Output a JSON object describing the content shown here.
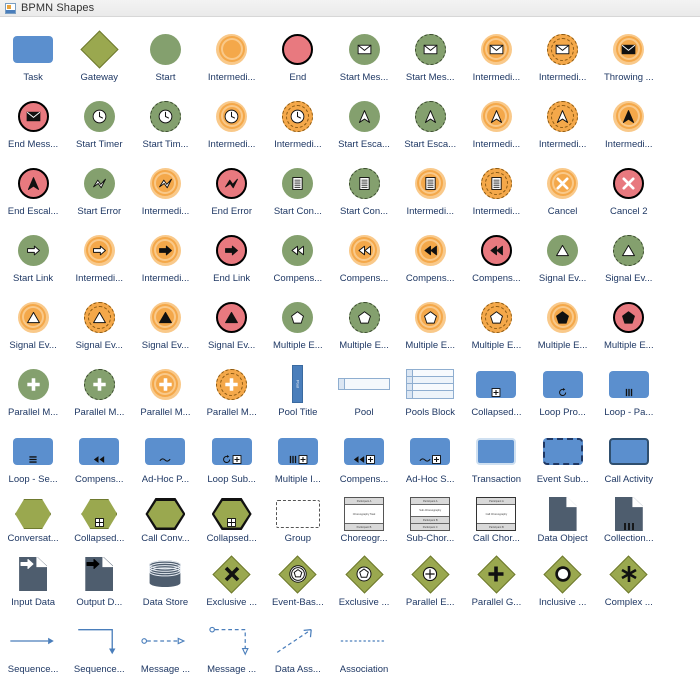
{
  "window": {
    "title": "BPMN Shapes",
    "icon": "bpmn-stencil-icon"
  },
  "theme": {
    "label_color": "#1f3864",
    "green": "#84a06e",
    "orange": "#f5a council",
    "orange_real": "#f3a council",
    "red": "#e8797f",
    "blue_task": "#5b8fce",
    "olive": "#9aa84f",
    "slate": "#4e5d6e",
    "connector_blue": "#4a7ebb"
  },
  "grid": {
    "columns": 10,
    "rows": 8,
    "total_shapes": 80
  },
  "shapes": [
    {
      "label": "Task",
      "kind": "task",
      "variant": "plain"
    },
    {
      "label": "Gateway",
      "kind": "diamond",
      "variant": "plain"
    },
    {
      "label": "Start",
      "kind": "event",
      "variant": "green-solid"
    },
    {
      "label": "Intermedi...",
      "kind": "event",
      "variant": "orange-double"
    },
    {
      "label": "End",
      "kind": "event",
      "variant": "red-thick"
    },
    {
      "label": "Start Mes...",
      "kind": "event",
      "variant": "green-solid",
      "glyph": "envelope-white"
    },
    {
      "label": "Start Mes...",
      "kind": "event",
      "variant": "green-dashed",
      "glyph": "envelope-white"
    },
    {
      "label": "Intermedi...",
      "kind": "event",
      "variant": "orange-double",
      "glyph": "envelope-white"
    },
    {
      "label": "Intermedi...",
      "kind": "event",
      "variant": "orange-dashdbl",
      "glyph": "envelope-white"
    },
    {
      "label": "Throwing ...",
      "kind": "event",
      "variant": "orange-double",
      "glyph": "envelope-black"
    },
    {
      "label": "End Mess...",
      "kind": "event",
      "variant": "red-thick",
      "glyph": "envelope-black"
    },
    {
      "label": "Start Timer",
      "kind": "event",
      "variant": "green-solid",
      "glyph": "clock"
    },
    {
      "label": "Start Tim...",
      "kind": "event",
      "variant": "green-dashed",
      "glyph": "clock"
    },
    {
      "label": "Intermedi...",
      "kind": "event",
      "variant": "orange-double",
      "glyph": "clock"
    },
    {
      "label": "Intermedi...",
      "kind": "event",
      "variant": "orange-dashdbl",
      "glyph": "clock"
    },
    {
      "label": "Start Esca...",
      "kind": "event",
      "variant": "green-solid",
      "glyph": "arrowhead-white"
    },
    {
      "label": "Start Esca...",
      "kind": "event",
      "variant": "green-dashed",
      "glyph": "arrowhead-white"
    },
    {
      "label": "Intermedi...",
      "kind": "event",
      "variant": "orange-double",
      "glyph": "arrowhead-white"
    },
    {
      "label": "Intermedi...",
      "kind": "event",
      "variant": "orange-dashdbl",
      "glyph": "arrowhead-white"
    },
    {
      "label": "Intermedi...",
      "kind": "event",
      "variant": "orange-double",
      "glyph": "arrowhead-black"
    },
    {
      "label": "End Escal...",
      "kind": "event",
      "variant": "red-thick",
      "glyph": "arrowhead-black"
    },
    {
      "label": "Start Error",
      "kind": "event",
      "variant": "green-solid",
      "glyph": "bolt-white"
    },
    {
      "label": "Intermedi...",
      "kind": "event",
      "variant": "orange-double",
      "glyph": "bolt-white"
    },
    {
      "label": "End Error",
      "kind": "event",
      "variant": "red-thick",
      "glyph": "bolt-black"
    },
    {
      "label": "Start Con...",
      "kind": "event",
      "variant": "green-solid",
      "glyph": "page-lines"
    },
    {
      "label": "Start Con...",
      "kind": "event",
      "variant": "green-dashed",
      "glyph": "page-lines"
    },
    {
      "label": "Intermedi...",
      "kind": "event",
      "variant": "orange-double",
      "glyph": "page-lines"
    },
    {
      "label": "Intermedi...",
      "kind": "event",
      "variant": "orange-dashdbl",
      "glyph": "page-lines"
    },
    {
      "label": "Cancel",
      "kind": "event",
      "variant": "orange-double",
      "glyph": "x-cross"
    },
    {
      "label": "Cancel 2",
      "kind": "event",
      "variant": "red-thick",
      "glyph": "x-cross"
    },
    {
      "label": "Start Link",
      "kind": "event",
      "variant": "green-solid",
      "glyph": "arrow-right-white"
    },
    {
      "label": "Intermedi...",
      "kind": "event",
      "variant": "orange-double",
      "glyph": "arrow-right-white"
    },
    {
      "label": "Intermedi...",
      "kind": "event",
      "variant": "orange-double",
      "glyph": "arrow-right-black"
    },
    {
      "label": "End Link",
      "kind": "event",
      "variant": "red-thick",
      "glyph": "arrow-right-black"
    },
    {
      "label": "Compens...",
      "kind": "event",
      "variant": "green-solid",
      "glyph": "rewind-white"
    },
    {
      "label": "Compens...",
      "kind": "event",
      "variant": "orange-double",
      "glyph": "rewind-white"
    },
    {
      "label": "Compens...",
      "kind": "event",
      "variant": "orange-double",
      "glyph": "rewind-black"
    },
    {
      "label": "Compens...",
      "kind": "event",
      "variant": "red-thick",
      "glyph": "rewind-black"
    },
    {
      "label": "Signal Ev...",
      "kind": "event",
      "variant": "green-solid",
      "glyph": "triangle-white"
    },
    {
      "label": "Signal Ev...",
      "kind": "event",
      "variant": "green-dashed",
      "glyph": "triangle-white"
    },
    {
      "label": "Signal Ev...",
      "kind": "event",
      "variant": "orange-double",
      "glyph": "triangle-white"
    },
    {
      "label": "Signal Ev...",
      "kind": "event",
      "variant": "orange-dashdbl",
      "glyph": "triangle-white"
    },
    {
      "label": "Signal Ev...",
      "kind": "event",
      "variant": "orange-double",
      "glyph": "triangle-black"
    },
    {
      "label": "Signal Ev...",
      "kind": "event",
      "variant": "red-thick",
      "glyph": "triangle-black"
    },
    {
      "label": "Multiple E...",
      "kind": "event",
      "variant": "green-solid",
      "glyph": "pentagon-white"
    },
    {
      "label": "Multiple E...",
      "kind": "event",
      "variant": "green-dashed",
      "glyph": "pentagon-white"
    },
    {
      "label": "Multiple E...",
      "kind": "event",
      "variant": "orange-double",
      "glyph": "pentagon-white"
    },
    {
      "label": "Multiple E...",
      "kind": "event",
      "variant": "orange-dashdbl",
      "glyph": "pentagon-white"
    },
    {
      "label": "Multiple E...",
      "kind": "event",
      "variant": "orange-double",
      "glyph": "pentagon-black"
    },
    {
      "label": "Multiple E...",
      "kind": "event",
      "variant": "red-thick",
      "glyph": "pentagon-black"
    },
    {
      "label": "Parallel M...",
      "kind": "event",
      "variant": "green-solid",
      "glyph": "plus-white"
    },
    {
      "label": "Parallel M...",
      "kind": "event",
      "variant": "green-dashed",
      "glyph": "plus-white"
    },
    {
      "label": "Parallel M...",
      "kind": "event",
      "variant": "orange-double",
      "glyph": "plus-white"
    },
    {
      "label": "Parallel M...",
      "kind": "event",
      "variant": "orange-dashdbl",
      "glyph": "plus-white"
    },
    {
      "label": "Pool Title",
      "kind": "pool-title"
    },
    {
      "label": "Pool",
      "kind": "pool"
    },
    {
      "label": "Pools Block",
      "kind": "pools-block"
    },
    {
      "label": "Collapsed...",
      "kind": "task",
      "variant": "plain",
      "marker": "subprocess-plus"
    },
    {
      "label": "Loop Pro...",
      "kind": "task",
      "variant": "plain",
      "marker": "loop"
    },
    {
      "label": "Loop - Pa...",
      "kind": "task",
      "variant": "plain",
      "marker": "parallel-mi"
    },
    {
      "label": "Loop - Se...",
      "kind": "task",
      "variant": "plain",
      "marker": "sequential-mi"
    },
    {
      "label": "Compens...",
      "kind": "task",
      "variant": "plain",
      "marker": "compensation"
    },
    {
      "label": "Ad-Hoc P...",
      "kind": "task",
      "variant": "plain",
      "marker": "tilde"
    },
    {
      "label": "Loop Sub...",
      "kind": "task",
      "variant": "plain",
      "marker": "loop-plus"
    },
    {
      "label": "Multiple I...",
      "kind": "task",
      "variant": "plain",
      "marker": "parallel-plus"
    },
    {
      "label": "Compens...",
      "kind": "task",
      "variant": "plain",
      "marker": "compensation-plus"
    },
    {
      "label": "Ad-Hoc S...",
      "kind": "task",
      "variant": "plain",
      "marker": "tilde-plus"
    },
    {
      "label": "Transaction",
      "kind": "task",
      "variant": "double-border"
    },
    {
      "label": "Event Sub...",
      "kind": "task",
      "variant": "dashed"
    },
    {
      "label": "Call Activity",
      "kind": "task",
      "variant": "thick"
    },
    {
      "label": "Conversat...",
      "kind": "hexagon",
      "marker": "none"
    },
    {
      "label": "Collapsed...",
      "kind": "hexagon",
      "marker": "grid-plus"
    },
    {
      "label": "Call Conv...",
      "kind": "hexagon-thick",
      "marker": "none"
    },
    {
      "label": "Collapsed...",
      "kind": "hexagon-thick",
      "marker": "grid-plus"
    },
    {
      "label": "Group",
      "kind": "group"
    },
    {
      "label": "Choreogr...",
      "kind": "choreography",
      "bands": [
        "Participant A",
        "Participant B"
      ],
      "body": "Choreography Task"
    },
    {
      "label": "Sub-Chor...",
      "kind": "sub-choreography",
      "bands": [
        "Participant A",
        "Participant B",
        "Participant C"
      ],
      "body": "Sub-Choreography"
    },
    {
      "label": "Call Chor...",
      "kind": "call-choreography",
      "bands": [
        "Participant A",
        "Participant B"
      ],
      "body": "Call Choreography"
    },
    {
      "label": "Data Object",
      "kind": "data-object"
    },
    {
      "label": "Collection...",
      "kind": "data-object",
      "marker": "collection"
    },
    {
      "label": "Input Data",
      "kind": "data-object",
      "marker": "input-arrow"
    },
    {
      "label": "Output D...",
      "kind": "data-object",
      "marker": "output-arrow"
    },
    {
      "label": "Data Store",
      "kind": "data-store"
    },
    {
      "label": "Exclusive ...",
      "kind": "diamond",
      "glyph": "x-thick"
    },
    {
      "label": "Event-Bas...",
      "kind": "diamond",
      "glyph": "event-pentagon-double"
    },
    {
      "label": "Exclusive ...",
      "kind": "diamond",
      "glyph": "event-pentagon"
    },
    {
      "label": "Parallel E...",
      "kind": "diamond",
      "glyph": "circle-plus"
    },
    {
      "label": "Parallel G...",
      "kind": "diamond",
      "glyph": "plus-thick"
    },
    {
      "label": "Inclusive ...",
      "kind": "diamond",
      "glyph": "circle-ring"
    },
    {
      "label": "Complex ...",
      "kind": "diamond",
      "glyph": "asterisk"
    },
    {
      "label": "Sequence...",
      "kind": "connector",
      "style": "solid-straight"
    },
    {
      "label": "Sequence...",
      "kind": "connector",
      "style": "solid-elbow"
    },
    {
      "label": "Message ...",
      "kind": "connector",
      "style": "dashed-straight"
    },
    {
      "label": "Message ...",
      "kind": "connector",
      "style": "dashed-elbow"
    },
    {
      "label": "Data Ass...",
      "kind": "connector",
      "style": "dashed-diagonal"
    },
    {
      "label": "Association",
      "kind": "connector",
      "style": "dotted"
    }
  ]
}
